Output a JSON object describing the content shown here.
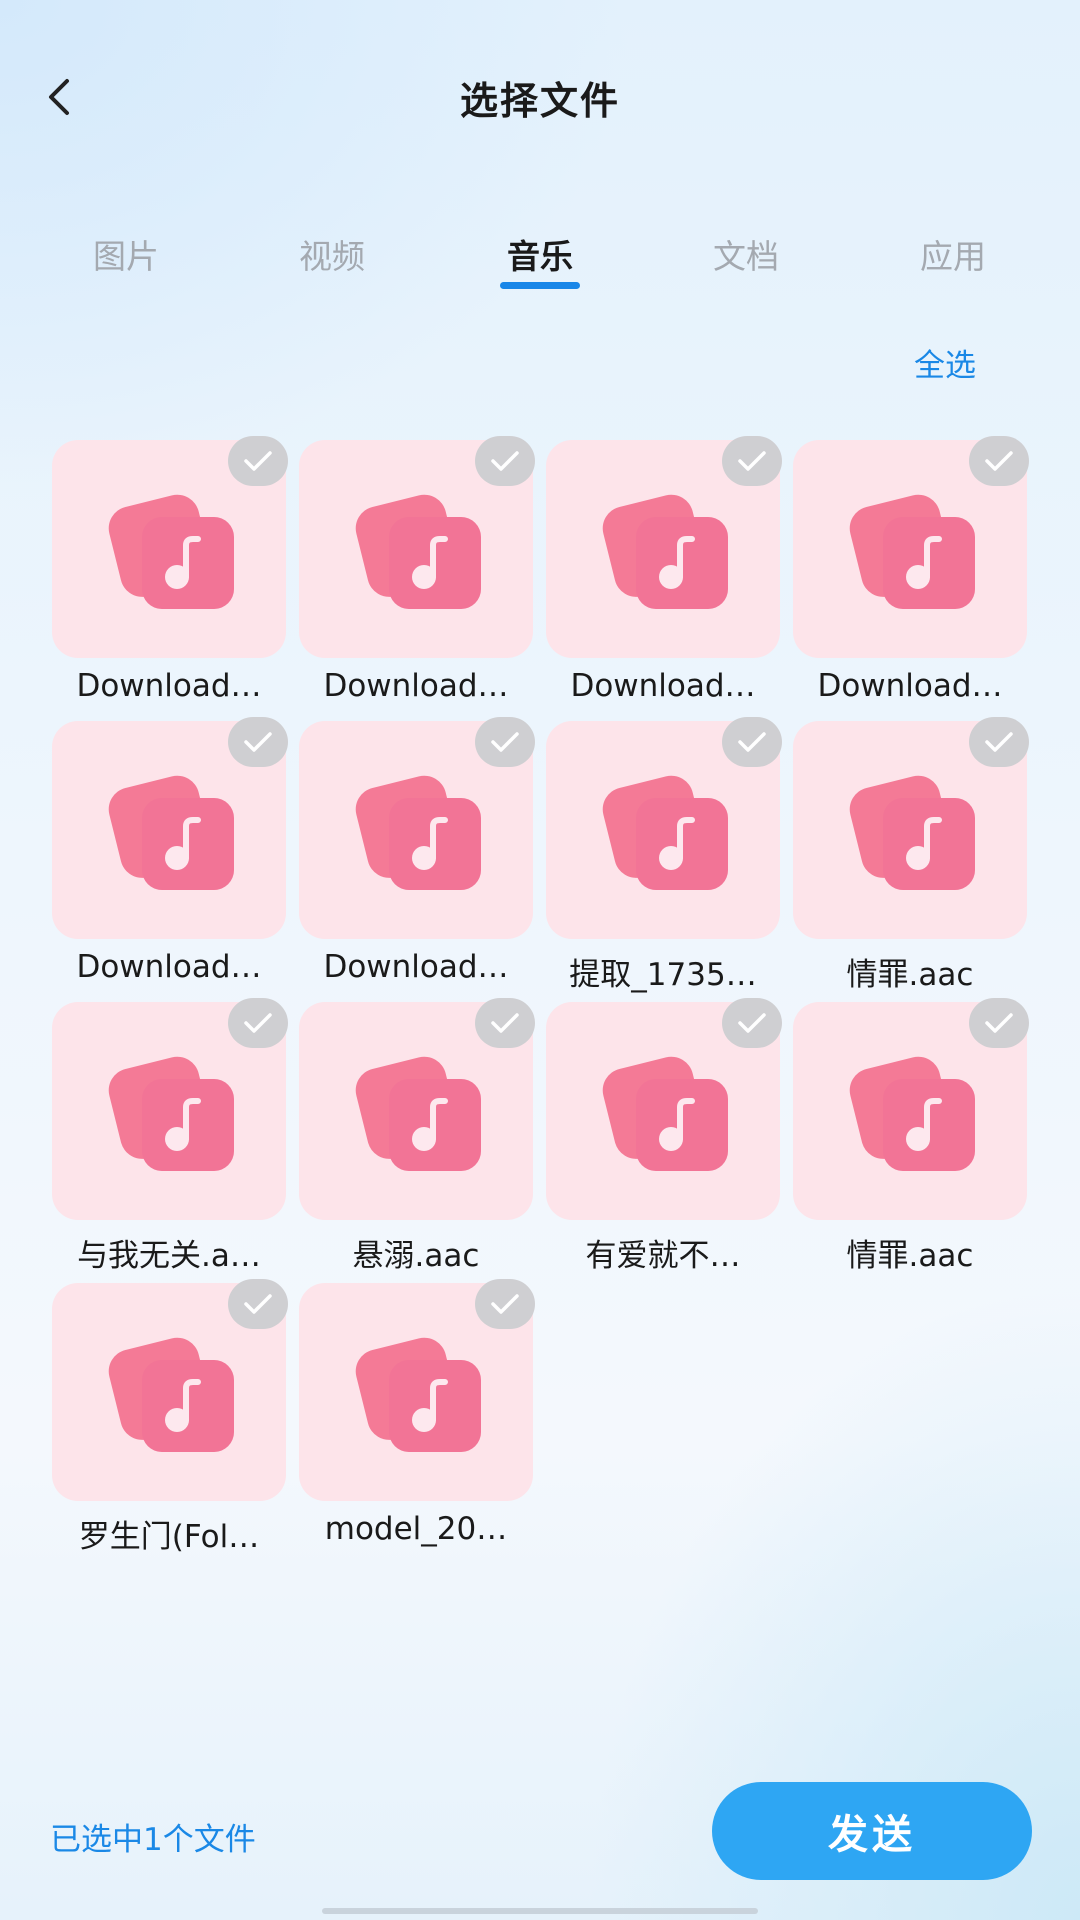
{
  "header": {
    "title": "选择文件",
    "back_icon": "chevron-left-icon"
  },
  "tabs": [
    {
      "label": "图片",
      "active": false
    },
    {
      "label": "视频",
      "active": false
    },
    {
      "label": "音乐",
      "active": true
    },
    {
      "label": "文档",
      "active": false
    },
    {
      "label": "应用",
      "active": false
    }
  ],
  "select_all_label": "全选",
  "files": [
    {
      "name": "Download…",
      "selected": false
    },
    {
      "name": "Download…",
      "selected": false
    },
    {
      "name": "Download…",
      "selected": false
    },
    {
      "name": "Download…",
      "selected": false
    },
    {
      "name": "Download…",
      "selected": false
    },
    {
      "name": "Download…",
      "selected": false
    },
    {
      "name": "提取_1735…",
      "selected": false
    },
    {
      "name": "情罪.aac",
      "selected": false
    },
    {
      "name": "与我无关.a…",
      "selected": false
    },
    {
      "name": "悬溺.aac",
      "selected": false
    },
    {
      "name": "有爱就不…",
      "selected": false
    },
    {
      "name": "情罪.aac",
      "selected": false
    },
    {
      "name": "罗生门(Fol…",
      "selected": false
    },
    {
      "name": "model_20…",
      "selected": false
    }
  ],
  "file_icon": "music-file-icon",
  "check_icon": "checkmark-icon",
  "footer": {
    "selected_text": "已选中1个文件",
    "send_label": "发送"
  },
  "colors": {
    "accent": "#1a88e6",
    "send_button": "#2ea6f3",
    "thumb_bg": "#fde4ea",
    "icon_pink": "#f2718f",
    "check_bg": "#cfcfd2"
  }
}
